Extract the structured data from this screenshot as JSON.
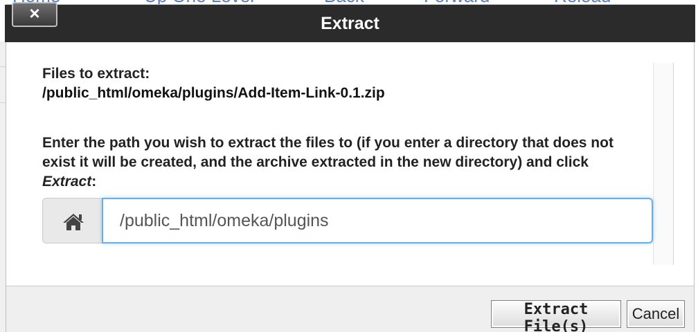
{
  "background": {
    "toolbar_items": [
      "Home",
      "Up One Level",
      "Back",
      "Forward",
      "Reload"
    ]
  },
  "dialog": {
    "title": "Extract",
    "close_label": "×",
    "files_label": "Files to extract:",
    "file_path": "/public_html/omeka/plugins/Add-Item-Link-0.1.zip",
    "instructions_prefix": "Enter the path you wish to extract the files to (if you enter a directory that does not exist it will be created, and the archive extracted in the new directory) and click ",
    "instructions_action": "Extract",
    "instructions_suffix": ":",
    "destination_value": "/public_html/omeka/plugins",
    "home_icon": "home-icon",
    "extract_button": "Extract File(s)",
    "cancel_button": "Cancel"
  },
  "colors": {
    "titlebar": "#2b2b2b",
    "focus_border": "#66afe9",
    "footer": "#efefef"
  }
}
